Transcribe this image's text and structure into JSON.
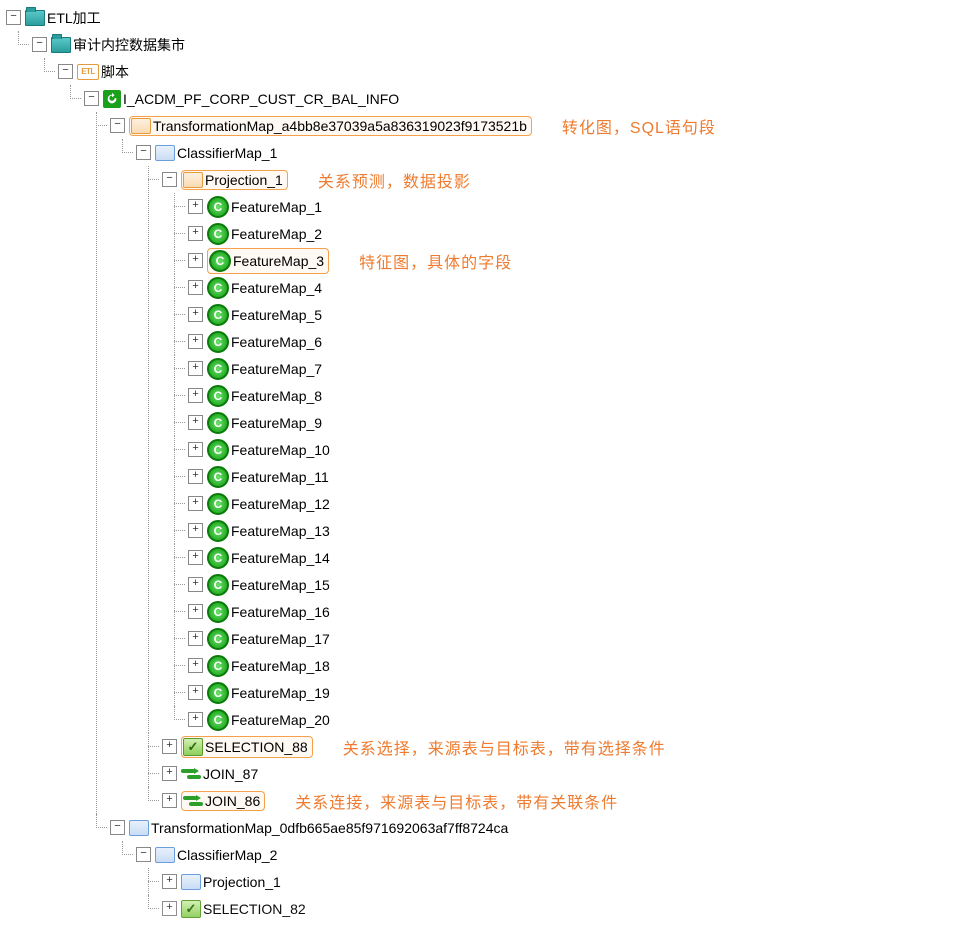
{
  "root": {
    "label": "ETL加工",
    "child1": {
      "label": "审计内控数据集市",
      "script": {
        "label": "脚本",
        "job": {
          "label": "I_ACDM_PF_CORP_CUST_CR_BAL_INFO",
          "tmap1": {
            "label": "TransformationMap_a4bb8e37039a5a836319023f9173521b",
            "annot": "转化图，SQL语句段",
            "cmap": {
              "label": "ClassifierMap_1",
              "proj": {
                "label": "Projection_1",
                "annot": "关系预测，数据投影",
                "fm_annot": "特征图，具体的字段",
                "features": [
                  "FeatureMap_1",
                  "FeatureMap_2",
                  "FeatureMap_3",
                  "FeatureMap_4",
                  "FeatureMap_5",
                  "FeatureMap_6",
                  "FeatureMap_7",
                  "FeatureMap_8",
                  "FeatureMap_9",
                  "FeatureMap_10",
                  "FeatureMap_11",
                  "FeatureMap_12",
                  "FeatureMap_13",
                  "FeatureMap_14",
                  "FeatureMap_15",
                  "FeatureMap_16",
                  "FeatureMap_17",
                  "FeatureMap_18",
                  "FeatureMap_19",
                  "FeatureMap_20"
                ]
              },
              "sel": {
                "label": "SELECTION_88",
                "annot": "关系选择，来源表与目标表，带有选择条件"
              },
              "join87": {
                "label": "JOIN_87"
              },
              "join86": {
                "label": "JOIN_86",
                "annot": "关系连接，来源表与目标表，带有关联条件"
              }
            }
          },
          "tmap2": {
            "label": "TransformationMap_0dfb665ae85f971692063af7ff8724ca",
            "cmap": {
              "label": "ClassifierMap_2",
              "proj": {
                "label": "Projection_1"
              },
              "sel": {
                "label": "SELECTION_82"
              }
            }
          }
        }
      }
    }
  }
}
